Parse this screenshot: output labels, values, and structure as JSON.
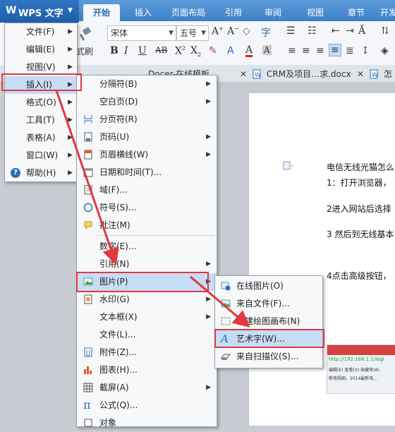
{
  "app": {
    "name": "WPS 文字"
  },
  "ribbon": {
    "tabs": [
      "开始",
      "插入",
      "页面布局",
      "引用",
      "审阅",
      "视图",
      "章节",
      "开发"
    ],
    "font_name": "宋体",
    "font_size": "五号",
    "format_painter_label": "式刷"
  },
  "doc_tabs": [
    "Docer-在线模板",
    "CRM及项目…求.docx",
    "怎"
  ],
  "document": {
    "lines": [
      "电信无线光猫怎么",
      "1：打开浏览器，",
      "2进入网站后选择",
      "3 然后到无线基本",
      "4点击高级按钮，"
    ],
    "screenshot_url": "http://192.168.1.1/logi",
    "screenshot_menu": "编辑(E)  查看(V)  收藏夹(A)",
    "screenshot_news": "新电视剧，2014最新电…"
  },
  "app_menu": [
    {
      "label": "文件(F)",
      "has_sub": true
    },
    {
      "label": "编辑(E)",
      "has_sub": true
    },
    {
      "label": "视图(V)",
      "has_sub": true
    },
    {
      "label": "插入(I)",
      "has_sub": true
    },
    {
      "label": "格式(O)",
      "has_sub": true
    },
    {
      "label": "工具(T)",
      "has_sub": true
    },
    {
      "label": "表格(A)",
      "has_sub": true
    },
    {
      "label": "窗口(W)",
      "has_sub": true
    },
    {
      "label": "帮助(H)",
      "has_sub": true
    }
  ],
  "insert_menu": [
    {
      "label": "分隔符(B)",
      "has_sub": true,
      "icon": ""
    },
    {
      "label": "空白页(D)",
      "has_sub": true,
      "icon": ""
    },
    {
      "label": "分页符(R)",
      "has_sub": false,
      "icon": "page-break-icon"
    },
    {
      "label": "页码(U)",
      "has_sub": true,
      "icon": "page-number-icon"
    },
    {
      "label": "页眉横线(W)",
      "has_sub": true,
      "icon": "header-line-icon"
    },
    {
      "label": "日期和时间(T)...",
      "has_sub": false,
      "icon": "calendar-icon"
    },
    {
      "label": "域(F)...",
      "has_sub": false,
      "icon": "field-icon"
    },
    {
      "label": "符号(S)...",
      "has_sub": false,
      "icon": "symbol-icon"
    },
    {
      "label": "批注(M)",
      "has_sub": false,
      "icon": "comment-icon"
    },
    {
      "label": "数字(E)...",
      "has_sub": false,
      "icon": ""
    },
    {
      "label": "引用(N)",
      "has_sub": true,
      "icon": ""
    },
    {
      "label": "图片(P)",
      "has_sub": true,
      "icon": "picture-icon"
    },
    {
      "label": "水印(G)",
      "has_sub": true,
      "icon": "watermark-icon"
    },
    {
      "label": "文本框(X)",
      "has_sub": true,
      "icon": ""
    },
    {
      "label": "文件(L)...",
      "has_sub": false,
      "icon": ""
    },
    {
      "label": "附件(Z)...",
      "has_sub": false,
      "icon": "attachment-icon"
    },
    {
      "label": "图表(H)...",
      "has_sub": false,
      "icon": "chart-icon"
    },
    {
      "label": "截屏(A)",
      "has_sub": true,
      "icon": "screenshot-icon"
    },
    {
      "label": "公式(Q)...",
      "has_sub": false,
      "icon": "formula-icon"
    },
    {
      "label": "对象",
      "has_sub": false,
      "icon": "object-icon"
    }
  ],
  "picture_menu": [
    {
      "label": "在线图片(O)",
      "icon": "online-picture-icon"
    },
    {
      "label": "来自文件(F)...",
      "icon": "picture-file-icon"
    },
    {
      "label": "新建绘图画布(N)",
      "icon": "canvas-icon"
    },
    {
      "label": "艺术字(W)...",
      "icon": "wordart-icon"
    },
    {
      "label": "来自扫描仪(S)...",
      "icon": "scanner-icon"
    }
  ],
  "watermark": "Baidu 经验",
  "watermark_url": "jingyan.baidu.com",
  "colors": {
    "accent": "#3f7fc4",
    "highlight": "#e0393e",
    "selection": "#c7dcf5"
  }
}
